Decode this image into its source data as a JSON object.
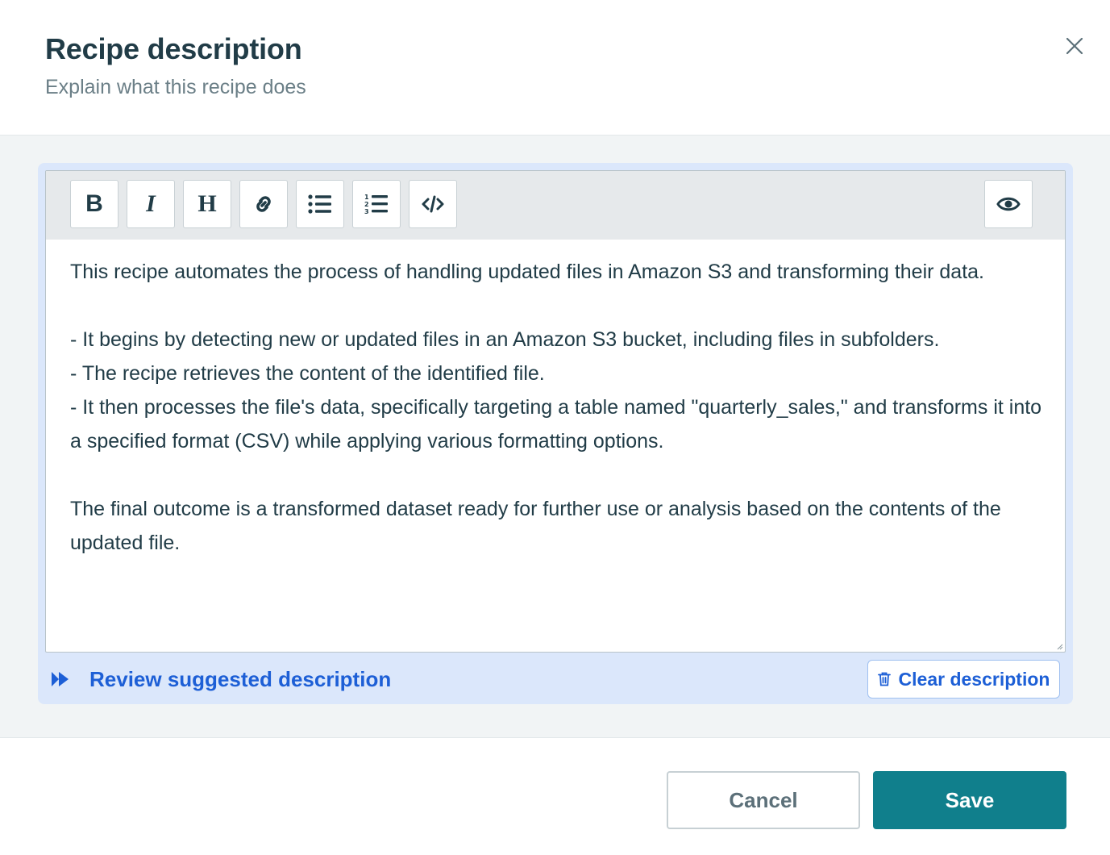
{
  "dialog": {
    "title": "Recipe description",
    "subtitle": "Explain what this recipe does",
    "close_icon": "close-icon"
  },
  "toolbar": {
    "buttons": [
      {
        "name": "bold",
        "glyph": "B",
        "icon": "bold-icon"
      },
      {
        "name": "italic",
        "glyph": "I",
        "icon": "italic-icon"
      },
      {
        "name": "heading",
        "glyph": "H",
        "icon": "heading-icon"
      },
      {
        "name": "link",
        "glyph": "",
        "icon": "link-icon"
      },
      {
        "name": "bullet-list",
        "glyph": "",
        "icon": "bullet-list-icon"
      },
      {
        "name": "numbered-list",
        "glyph": "",
        "icon": "numbered-list-icon"
      },
      {
        "name": "code",
        "glyph": "",
        "icon": "code-icon"
      }
    ],
    "preview_icon": "eye-icon"
  },
  "editor": {
    "paragraphs": [
      "This recipe automates the process of handling updated files in Amazon S3 and transforming their data.",
      "",
      "- It begins by detecting new or updated files in an Amazon S3 bucket, including files in subfolders.",
      "- The recipe retrieves the content of the identified file.",
      "- It then processes the file's data, specifically targeting a table named \"quarterly_sales,\" and transforms it into a specified format (CSV) while applying various formatting options.",
      "",
      "The final outcome is a transformed dataset ready for further use or analysis based on the contents of the updated file."
    ]
  },
  "assist": {
    "suggest_label": "Review suggested description",
    "suggest_icon": "double-chevron-icon",
    "clear_label": "Clear description",
    "clear_icon": "trash-icon"
  },
  "actions": {
    "cancel_label": "Cancel",
    "save_label": "Save"
  },
  "colors": {
    "primary": "#107f8c",
    "link_blue": "#1d5fd6",
    "text_dark": "#213c47",
    "panel_bg": "#f1f4f5",
    "assist_bg": "#dbe7fb"
  }
}
